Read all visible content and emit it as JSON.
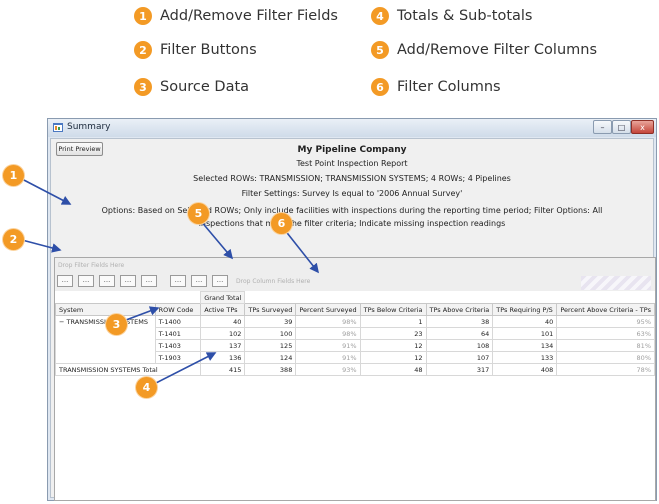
{
  "legend": [
    {
      "number": "1",
      "label": "Add/Remove Filter Fields"
    },
    {
      "number": "2",
      "label": "Filter Buttons"
    },
    {
      "number": "3",
      "label": "Source Data"
    },
    {
      "number": "4",
      "label": "Totals & Sub-totals"
    },
    {
      "number": "5",
      "label": "Add/Remove Filter Columns"
    },
    {
      "number": "6",
      "label": "Filter Columns"
    }
  ],
  "window": {
    "title": "Summary",
    "controls": {
      "minimize": "–",
      "maximize": "□",
      "close": "x"
    }
  },
  "toolbar": {
    "print_preview_label": "Print Preview"
  },
  "report": {
    "company": "My Pipeline Company",
    "subtitle": "Test Point Inspection Report",
    "selected_rows": "Selected ROWs: TRANSMISSION; TRANSMISSION SYSTEMS; 4 ROWs; 4 Pipelines",
    "filter_settings": "Filter Settings: Survey Is equal to '2006 Annual Survey'",
    "options_line1": "Options: Based on Selected ROWs; Only include facilities with inspections during the reporting time period; Filter Options: All",
    "options_line2": "inspections that meet the filter criteria; Indicate missing inspection readings"
  },
  "pivot": {
    "filter_area_placeholder": "Drop Filter Fields Here",
    "column_area_placeholder": "Drop Column Fields Here",
    "filter_buttons": [
      "...",
      "...",
      "...",
      "...",
      "...",
      "...",
      "...",
      "..."
    ],
    "grand_total_label": "Grand Total",
    "headers": [
      "System",
      "ROW Code",
      "Active TPs",
      "TPs Surveyed",
      "Percent Surveyed",
      "TPs Below Criteria",
      "TPs Above Criteria",
      "TPs Requiring P/S",
      "Percent Above Criteria - TPs"
    ],
    "group_label": "TRANSMISSION SYSTEMS",
    "expander": "−",
    "rows": [
      {
        "code": "T-1400",
        "active": "40",
        "surveyed": "39",
        "percent": "98%",
        "below": "1",
        "above": "38",
        "requiring": "40",
        "pct_above": "95%"
      },
      {
        "code": "T-1401",
        "active": "102",
        "surveyed": "100",
        "percent": "98%",
        "below": "23",
        "above": "64",
        "requiring": "101",
        "pct_above": "63%"
      },
      {
        "code": "T-1403",
        "active": "137",
        "surveyed": "125",
        "percent": "91%",
        "below": "12",
        "above": "108",
        "requiring": "134",
        "pct_above": "81%"
      },
      {
        "code": "T-1903",
        "active": "136",
        "surveyed": "124",
        "percent": "91%",
        "below": "12",
        "above": "107",
        "requiring": "133",
        "pct_above": "80%"
      }
    ],
    "total": {
      "label": "TRANSMISSION SYSTEMS Total",
      "active": "415",
      "surveyed": "388",
      "percent": "93%",
      "below": "48",
      "above": "317",
      "requiring": "408",
      "pct_above": "78%"
    }
  },
  "callouts": [
    "1",
    "2",
    "3",
    "4",
    "5",
    "6"
  ],
  "colors": {
    "callout": "#f39a25",
    "arrow": "#2e4fa8"
  }
}
